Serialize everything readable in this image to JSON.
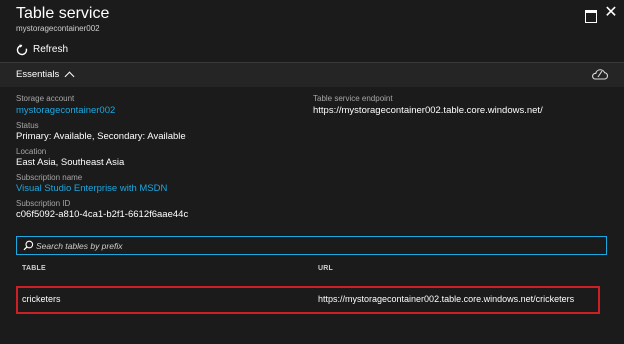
{
  "blade": {
    "title": "Table service",
    "subtitle": "mystoragecontainer002"
  },
  "toolbar": {
    "refresh_label": "Refresh"
  },
  "essentials": {
    "label": "Essentials"
  },
  "properties": {
    "storage_account_label": "Storage account",
    "storage_account_value": "mystoragecontainer002",
    "status_label": "Status",
    "status_value": "Primary: Available, Secondary: Available",
    "location_label": "Location",
    "location_value": "East Asia, Southeast Asia",
    "subscription_name_label": "Subscription name",
    "subscription_name_value": "Visual Studio Enterprise with MSDN",
    "subscription_id_label": "Subscription ID",
    "subscription_id_value": "c06f5092-a810-4ca1-b2f1-6612f6aae44c",
    "endpoint_label": "Table service endpoint",
    "endpoint_value": "https://mystoragecontainer002.table.core.windows.net/"
  },
  "search": {
    "placeholder": "Search tables by prefix"
  },
  "table": {
    "columns": [
      "TABLE",
      "URL"
    ],
    "rows": [
      {
        "table": "cricketers",
        "url": "https://mystoragecontainer002.table.core.windows.net/cricketers"
      }
    ]
  },
  "colors": {
    "background": "#1b1b1b",
    "link": "#1ca8e0",
    "highlight": "#cc1f26",
    "search_border": "#1ca8e0"
  },
  "icons": {
    "refresh": "refresh-icon",
    "maximize": "maximize-icon",
    "close": "close-icon",
    "chevron": "chevron-up-icon",
    "cloud": "cloud-icon",
    "search": "search-icon"
  }
}
